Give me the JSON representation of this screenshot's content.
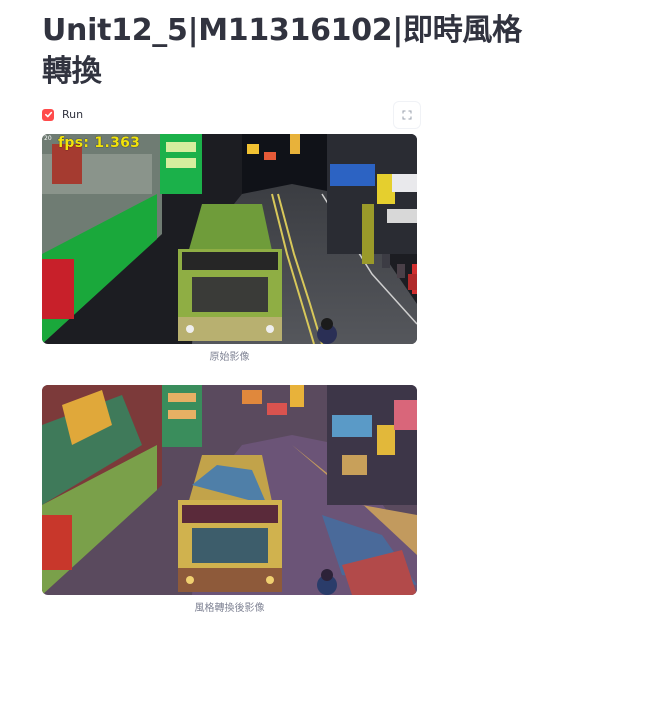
{
  "page": {
    "title": "Unit12_5|M11316102|即時風格轉換"
  },
  "controls": {
    "run_label": "Run",
    "run_checked": true,
    "accent_color": "#ff4b4b"
  },
  "video": {
    "fps_text": "fps: 1.363",
    "original_caption": "原始影像",
    "styled_caption": "風格轉換後影像"
  },
  "icons": {
    "checkbox": "check-icon",
    "fullscreen": "fullscreen-icon"
  }
}
